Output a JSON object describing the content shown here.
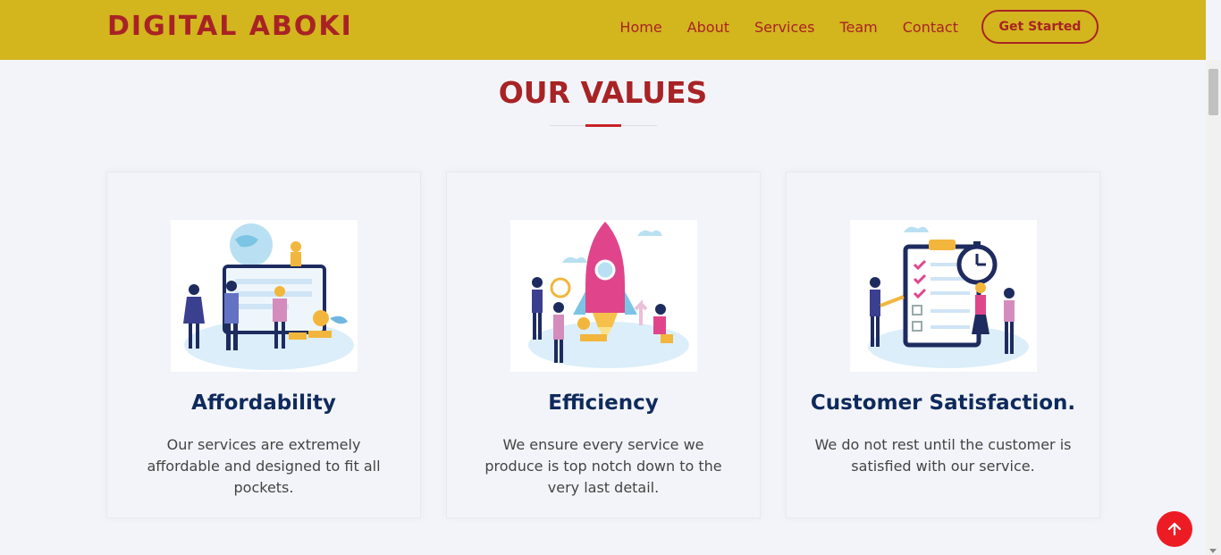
{
  "brand": {
    "name": "DIGITAL ABOKI"
  },
  "nav": {
    "items": [
      {
        "label": "Home"
      },
      {
        "label": "About"
      },
      {
        "label": "Services"
      },
      {
        "label": "Team"
      },
      {
        "label": "Contact"
      }
    ],
    "cta_label": "Get Started"
  },
  "values": {
    "title": "OUR VALUES",
    "cards": [
      {
        "title": "Affordability",
        "text": "Our services are extremely affordable and designed to fit all pockets.",
        "icon": "finance-team-illustration"
      },
      {
        "title": "Efficiency",
        "text": "We ensure every service we produce is top notch down to the very last detail.",
        "icon": "rocket-launch-illustration"
      },
      {
        "title": "Customer Satisfaction.",
        "text": "We do not rest until the customer is satisfied with our service.",
        "icon": "checklist-clock-illustration"
      }
    ]
  },
  "colors": {
    "header": "#d3b51e",
    "brand": "#a82325",
    "heading": "#0e2a5d",
    "back_to_top": "#ed1c24"
  },
  "back_to_top": {
    "icon": "arrow-up-icon"
  }
}
